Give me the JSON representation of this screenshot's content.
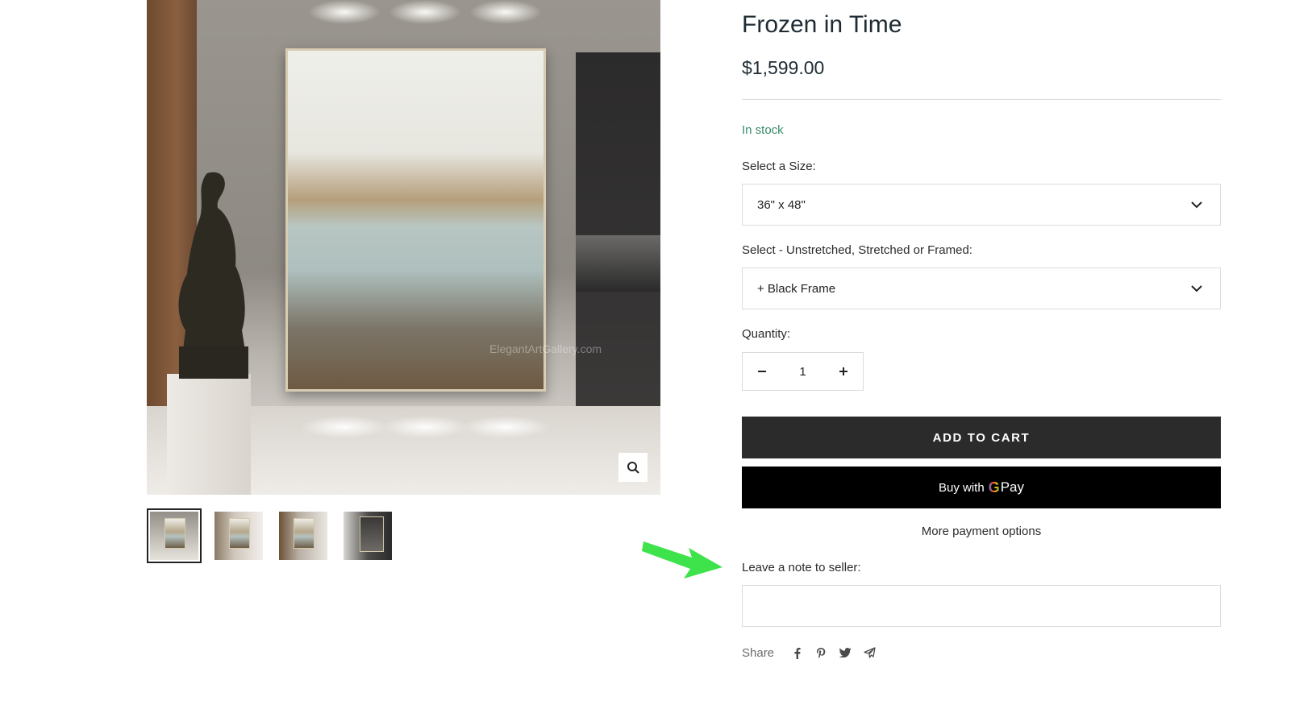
{
  "product": {
    "title": "Frozen in Time",
    "price": "$1,599.00",
    "stock_status": "In stock",
    "stock_color": "#3a8a68"
  },
  "gallery": {
    "watermark": "ElegantArtGallery.com",
    "zoom_icon": "magnifier-icon",
    "thumbnails": [
      {
        "alt": "thumbnail 1",
        "active": true
      },
      {
        "alt": "thumbnail 2",
        "active": false
      },
      {
        "alt": "thumbnail 3",
        "active": false
      },
      {
        "alt": "thumbnail 4",
        "active": false
      }
    ]
  },
  "options": {
    "size_label": "Select a Size:",
    "size_value": "36\" x 48\"",
    "frame_label": "Select - Unstretched, Stretched or Framed:",
    "frame_value": "+ Black Frame"
  },
  "quantity": {
    "label": "Quantity:",
    "value": "1",
    "minus": "−",
    "plus": "+"
  },
  "buttons": {
    "add_to_cart": "ADD TO CART",
    "gpay_prefix": "Buy with",
    "gpay_g": "G",
    "gpay_pay": "Pay",
    "more_payment": "More payment options"
  },
  "note": {
    "label": "Leave a note to seller:",
    "value": ""
  },
  "share": {
    "label": "Share",
    "icons": [
      "facebook-icon",
      "pinterest-icon",
      "twitter-icon",
      "email-icon"
    ]
  },
  "annotation": {
    "arrow_color": "#3ee24a"
  },
  "colors": {
    "button_dark": "#2b2b2b",
    "gpay_bg": "#000000",
    "title": "#1e2b33"
  }
}
